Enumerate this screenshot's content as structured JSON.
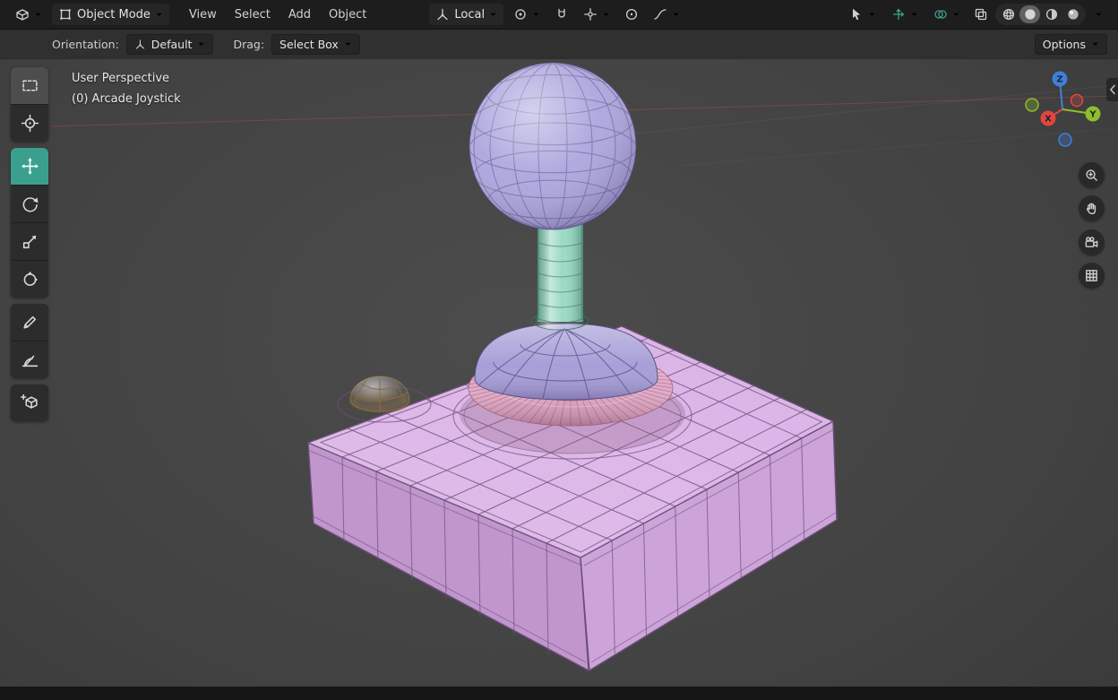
{
  "topbar": {
    "editor": {
      "icon": "editor-3d-viewport-icon"
    },
    "mode": {
      "label": "Object Mode",
      "icon": "object-mode-icon"
    },
    "menus": [
      {
        "label": "View"
      },
      {
        "label": "Select"
      },
      {
        "label": "Add"
      },
      {
        "label": "Object"
      }
    ],
    "orientation": {
      "label": "Local",
      "icon": "orientation-axes-icon"
    },
    "right": {
      "shading_modes": [
        "wireframe",
        "solid",
        "material-preview",
        "rendered"
      ],
      "shading_active": "solid"
    }
  },
  "tool_settings": {
    "orientation_label": "Orientation:",
    "orientation_value": "Default",
    "drag_label": "Drag:",
    "drag_value": "Select Box",
    "options_label": "Options"
  },
  "toolbar": {
    "tools": [
      "select-box",
      "cursor",
      "move",
      "rotate",
      "scale",
      "transform",
      "annotate",
      "measure",
      "add-cube"
    ],
    "active_tool": "move"
  },
  "viewport": {
    "overlay_line1": "User Perspective",
    "overlay_line2": "(0) Arcade Joystick",
    "axis_labels": {
      "x": "X",
      "y": "Y",
      "z": "Z"
    }
  },
  "scene": {
    "object_name": "Arcade Joystick",
    "colors": {
      "accent": "#3aa08d",
      "axis_x": "#e4453f",
      "axis_y": "#8fbe2a",
      "axis_z": "#3f7fd9",
      "ball": "#a9a2dc",
      "stick": "#96d8c2",
      "dome": "#a59dd6",
      "ring": "#e0a6c4",
      "base_top": "#dbb4e7",
      "base_left": "#c096cd",
      "base_right": "#cda4d9",
      "button": "#ddc28e",
      "wire_base": "#6b4f78",
      "wire_ball": "#564b80",
      "wire_stick": "#3f7a68",
      "wire_dome": "#554a80",
      "wire_ring": "#a25f80",
      "wire_button": "#8a6c42"
    }
  }
}
